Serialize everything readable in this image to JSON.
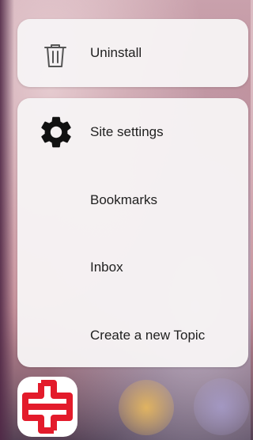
{
  "menu": {
    "uninstall": {
      "label": "Uninstall",
      "icon": "trash-icon"
    },
    "items": [
      {
        "label": "Site settings",
        "icon": "gear-icon"
      },
      {
        "label": "Bookmarks"
      },
      {
        "label": "Inbox"
      },
      {
        "label": "Create a new Topic"
      }
    ]
  },
  "app": {
    "icon": "app-logo-icon",
    "brand_color": "#e31b2b"
  },
  "colors": {
    "card_background": "#f6f3f4",
    "text": "#1f1f1f"
  }
}
